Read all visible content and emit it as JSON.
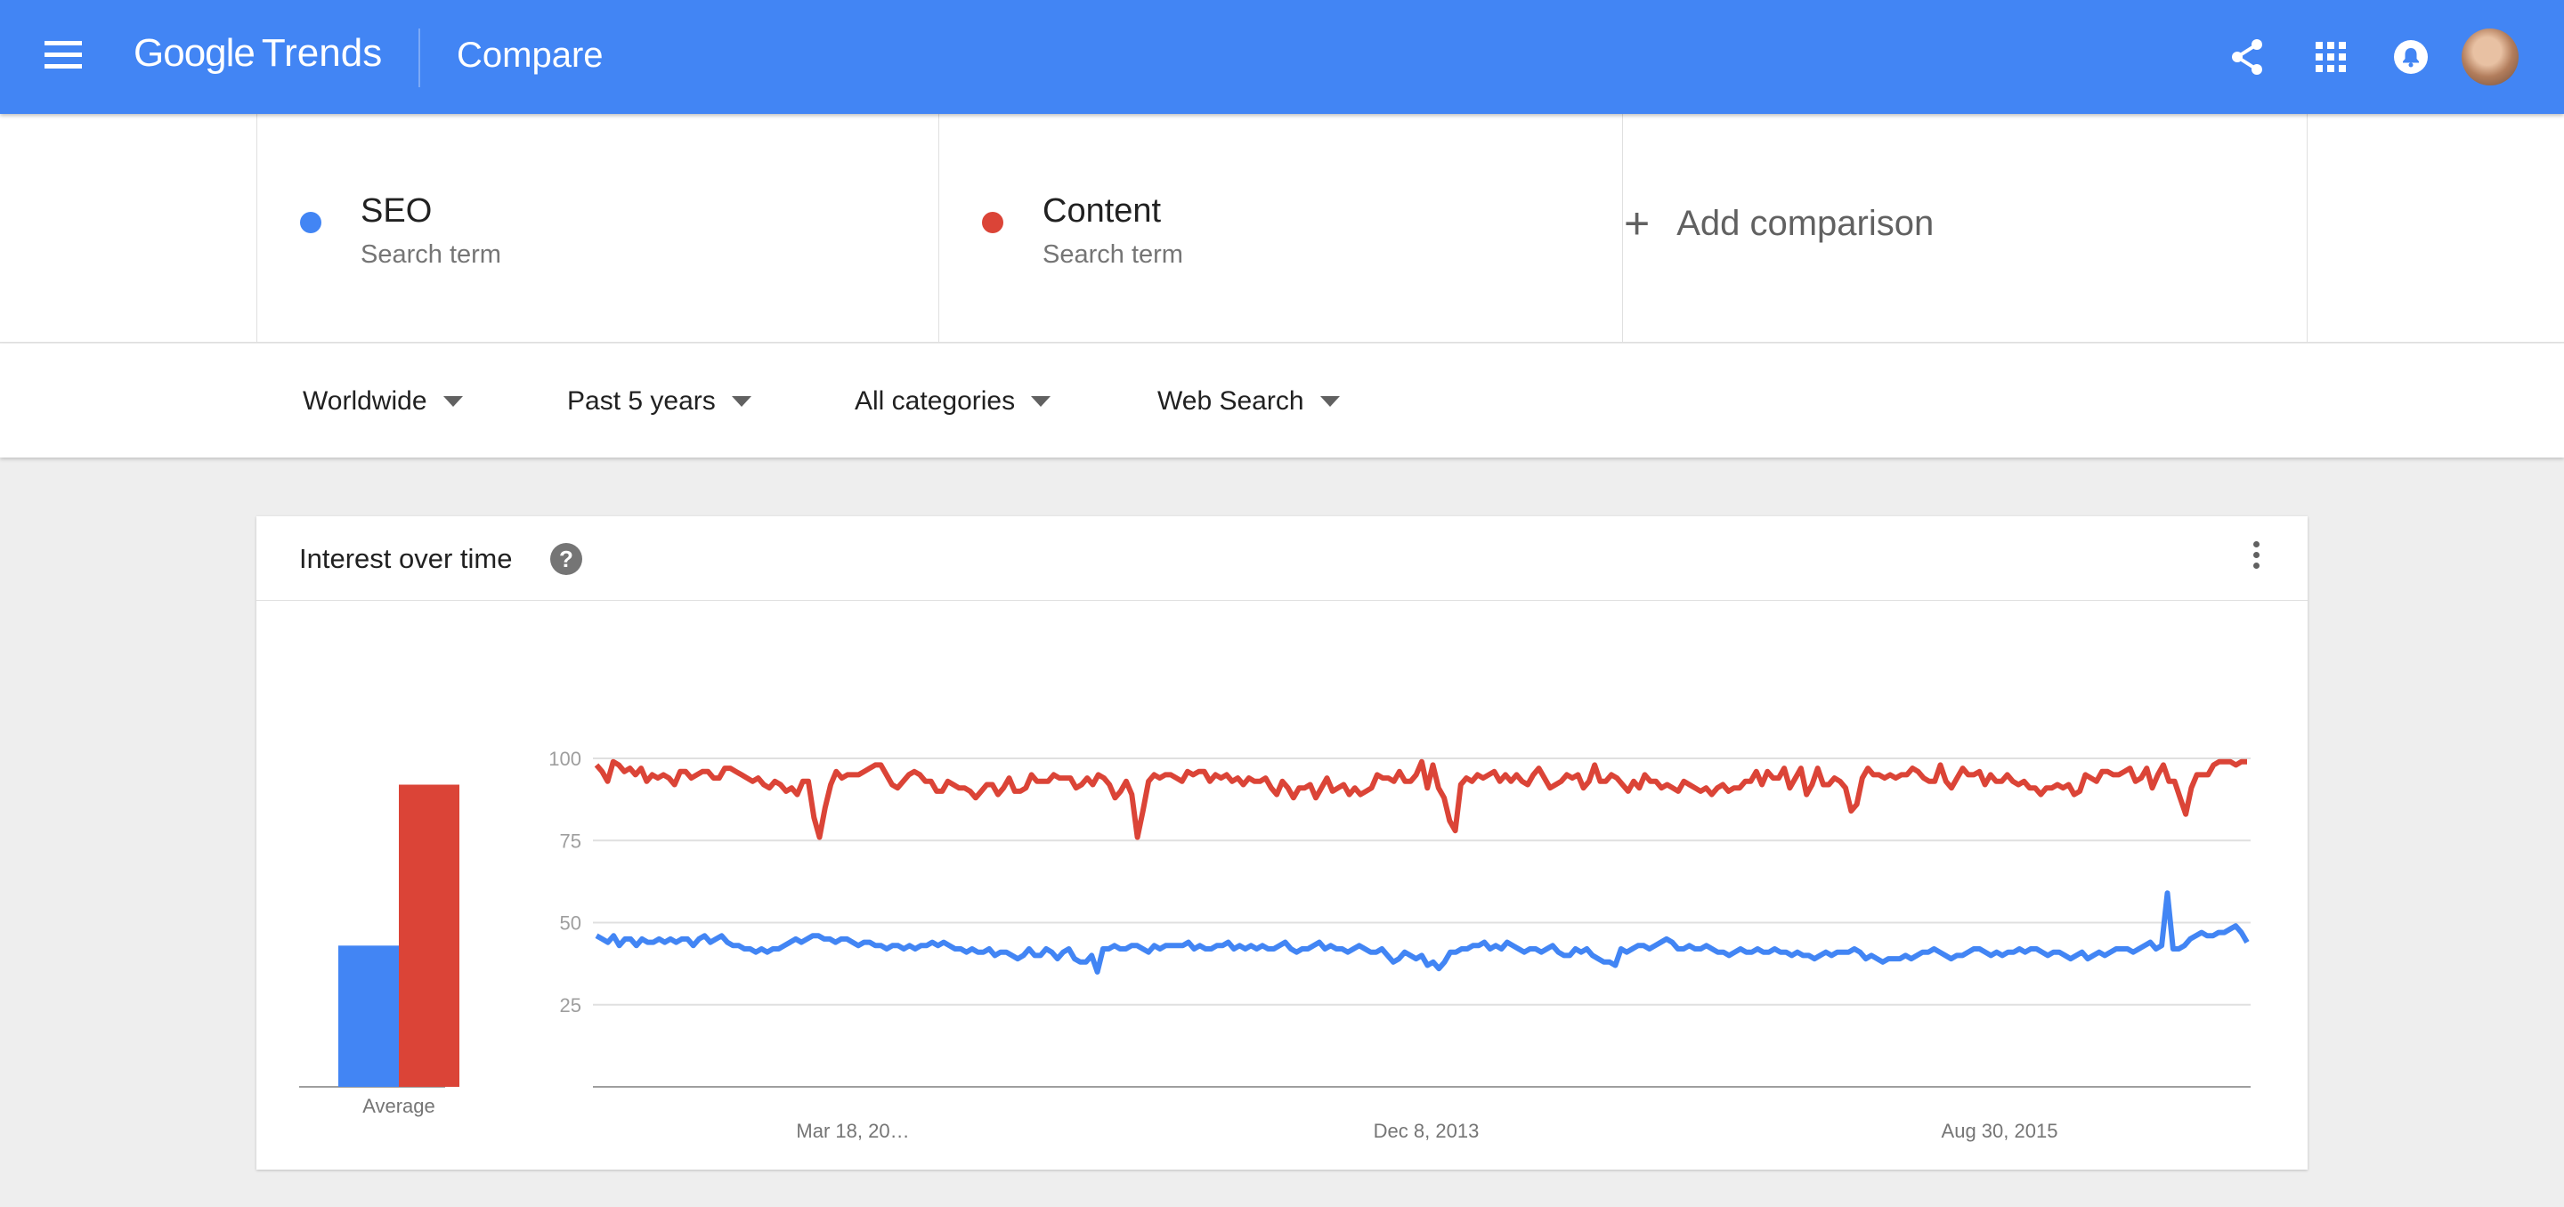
{
  "header": {
    "logo_google": "Google",
    "logo_trends": "Trends",
    "page_title": "Compare"
  },
  "terms": [
    {
      "name": "SEO",
      "type": "Search term",
      "color": "#4285f4"
    },
    {
      "name": "Content",
      "type": "Search term",
      "color": "#db4437"
    }
  ],
  "add_comparison": {
    "icon": "+",
    "label": "Add comparison"
  },
  "filters": {
    "region": "Worldwide",
    "period": "Past 5 years",
    "category": "All categories",
    "search_type": "Web Search"
  },
  "card": {
    "title": "Interest over time",
    "help": "?"
  },
  "chart_data": [
    {
      "type": "bar",
      "categories": [
        "Average"
      ],
      "series": [
        {
          "name": "SEO",
          "values": [
            43
          ]
        },
        {
          "name": "Content",
          "values": [
            92
          ]
        }
      ],
      "xlabel": "Average",
      "colors": [
        "#4285f4",
        "#db4437"
      ]
    },
    {
      "type": "line",
      "x_tick_labels": [
        "Mar 18, 20…",
        "Dec 8, 2013",
        "Aug 30, 2015"
      ],
      "y_ticks": [
        25,
        50,
        75,
        100
      ],
      "ylim": [
        0,
        100
      ],
      "grid": true,
      "series": [
        {
          "name": "Content",
          "color": "#db4437",
          "values": [
            98,
            96,
            93,
            99,
            98,
            96,
            97,
            95,
            97,
            93,
            95,
            94,
            95,
            94,
            92,
            96,
            96,
            94,
            95,
            96,
            96,
            94,
            94,
            97,
            97,
            96,
            95,
            94,
            93,
            94,
            92,
            91,
            93,
            92,
            90,
            91,
            89,
            93,
            93,
            82,
            76,
            85,
            92,
            96,
            94,
            95,
            95,
            95,
            96,
            97,
            98,
            98,
            95,
            92,
            91,
            93,
            95,
            96,
            95,
            93,
            93,
            90,
            90,
            93,
            92,
            91,
            91,
            90,
            88,
            90,
            92,
            92,
            89,
            91,
            94,
            90,
            90,
            91,
            95,
            93,
            93,
            93,
            95,
            94,
            94,
            94,
            91,
            92,
            94,
            92,
            95,
            94,
            92,
            88,
            90,
            93,
            89,
            76,
            84,
            93,
            95,
            94,
            95,
            95,
            94,
            93,
            96,
            95,
            96,
            96,
            93,
            95,
            94,
            95,
            93,
            94,
            92,
            94,
            93,
            93,
            94,
            91,
            89,
            93,
            91,
            88,
            91,
            91,
            92,
            88,
            91,
            94,
            90,
            91,
            92,
            89,
            91,
            89,
            90,
            91,
            95,
            94,
            94,
            93,
            96,
            93,
            93,
            95,
            99,
            91,
            98,
            91,
            88,
            81,
            78,
            92,
            94,
            93,
            95,
            94,
            95,
            96,
            93,
            95,
            93,
            95,
            93,
            92,
            95,
            97,
            94,
            91,
            92,
            93,
            95,
            94,
            95,
            91,
            93,
            98,
            93,
            93,
            95,
            94,
            92,
            90,
            93,
            91,
            95,
            93,
            93,
            91,
            92,
            91,
            90,
            93,
            92,
            91,
            90,
            91,
            89,
            91,
            92,
            90,
            91,
            91,
            93,
            93,
            96,
            92,
            96,
            94,
            94,
            97,
            91,
            94,
            97,
            89,
            92,
            97,
            92,
            92,
            94,
            93,
            91,
            84,
            86,
            94,
            97,
            95,
            95,
            94,
            95,
            94,
            95,
            95,
            97,
            96,
            94,
            93,
            93,
            98,
            93,
            91,
            94,
            97,
            95,
            95,
            96,
            92,
            95,
            93,
            93,
            95,
            93,
            92,
            93,
            91,
            91,
            89,
            91,
            91,
            92,
            91,
            92,
            89,
            90,
            95,
            94,
            93,
            96,
            96,
            95,
            95,
            96,
            97,
            93,
            94,
            97,
            91,
            95,
            98,
            93,
            93,
            88,
            83,
            91,
            95,
            95,
            95,
            98,
            99,
            99,
            99,
            98,
            99,
            99
          ]
        },
        {
          "name": "SEO",
          "color": "#4285f4",
          "values": [
            46,
            45,
            44,
            46,
            43,
            45,
            45,
            43,
            45,
            44,
            44,
            45,
            44,
            45,
            44,
            45,
            45,
            43,
            45,
            46,
            44,
            45,
            46,
            44,
            43,
            43,
            42,
            42,
            41,
            42,
            41,
            42,
            42,
            43,
            44,
            45,
            44,
            45,
            46,
            46,
            45,
            45,
            44,
            45,
            45,
            44,
            43,
            44,
            44,
            43,
            43,
            42,
            43,
            43,
            42,
            43,
            42,
            43,
            43,
            44,
            43,
            44,
            43,
            42,
            42,
            41,
            42,
            41,
            41,
            42,
            40,
            41,
            41,
            40,
            39,
            40,
            42,
            40,
            40,
            42,
            41,
            39,
            41,
            42,
            39,
            38,
            38,
            40,
            35,
            42,
            42,
            43,
            42,
            42,
            43,
            43,
            42,
            41,
            43,
            42,
            43,
            43,
            43,
            43,
            44,
            42,
            43,
            42,
            42,
            43,
            43,
            44,
            42,
            43,
            42,
            43,
            42,
            43,
            42,
            42,
            43,
            44,
            42,
            41,
            42,
            42,
            43,
            44,
            42,
            43,
            42,
            42,
            41,
            42,
            43,
            42,
            41,
            41,
            42,
            40,
            38,
            39,
            41,
            40,
            39,
            40,
            37,
            38,
            36,
            38,
            41,
            41,
            42,
            42,
            43,
            43,
            44,
            42,
            43,
            42,
            44,
            43,
            42,
            41,
            42,
            42,
            41,
            42,
            43,
            41,
            40,
            40,
            42,
            41,
            42,
            40,
            39,
            38,
            38,
            37,
            42,
            41,
            42,
            43,
            43,
            42,
            43,
            44,
            45,
            44,
            42,
            42,
            43,
            42,
            42,
            43,
            42,
            41,
            41,
            40,
            41,
            42,
            41,
            41,
            42,
            41,
            41,
            42,
            41,
            41,
            40,
            41,
            40,
            40,
            39,
            40,
            41,
            40,
            41,
            41,
            41,
            42,
            41,
            39,
            40,
            39,
            38,
            39,
            39,
            39,
            40,
            39,
            40,
            41,
            41,
            42,
            41,
            40,
            39,
            40,
            40,
            41,
            42,
            42,
            41,
            40,
            41,
            40,
            41,
            41,
            42,
            41,
            42,
            42,
            41,
            40,
            41,
            41,
            40,
            39,
            40,
            41,
            39,
            40,
            41,
            40,
            41,
            42,
            42,
            42,
            41,
            42,
            43,
            44,
            42,
            43,
            59,
            42,
            42,
            43,
            45,
            46,
            47,
            46,
            46,
            47,
            47,
            48,
            49,
            47,
            44
          ]
        }
      ]
    }
  ]
}
